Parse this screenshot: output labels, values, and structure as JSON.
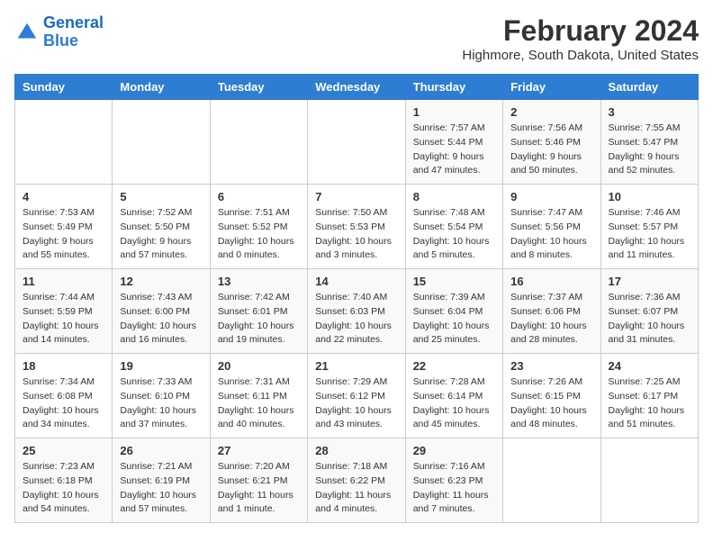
{
  "header": {
    "logo_line1": "General",
    "logo_line2": "Blue",
    "main_title": "February 2024",
    "subtitle": "Highmore, South Dakota, United States"
  },
  "columns": [
    "Sunday",
    "Monday",
    "Tuesday",
    "Wednesday",
    "Thursday",
    "Friday",
    "Saturday"
  ],
  "rows": [
    [
      {
        "day": "",
        "info": ""
      },
      {
        "day": "",
        "info": ""
      },
      {
        "day": "",
        "info": ""
      },
      {
        "day": "",
        "info": ""
      },
      {
        "day": "1",
        "info": "Sunrise: 7:57 AM\nSunset: 5:44 PM\nDaylight: 9 hours and 47 minutes."
      },
      {
        "day": "2",
        "info": "Sunrise: 7:56 AM\nSunset: 5:46 PM\nDaylight: 9 hours and 50 minutes."
      },
      {
        "day": "3",
        "info": "Sunrise: 7:55 AM\nSunset: 5:47 PM\nDaylight: 9 hours and 52 minutes."
      }
    ],
    [
      {
        "day": "4",
        "info": "Sunrise: 7:53 AM\nSunset: 5:49 PM\nDaylight: 9 hours and 55 minutes."
      },
      {
        "day": "5",
        "info": "Sunrise: 7:52 AM\nSunset: 5:50 PM\nDaylight: 9 hours and 57 minutes."
      },
      {
        "day": "6",
        "info": "Sunrise: 7:51 AM\nSunset: 5:52 PM\nDaylight: 10 hours and 0 minutes."
      },
      {
        "day": "7",
        "info": "Sunrise: 7:50 AM\nSunset: 5:53 PM\nDaylight: 10 hours and 3 minutes."
      },
      {
        "day": "8",
        "info": "Sunrise: 7:48 AM\nSunset: 5:54 PM\nDaylight: 10 hours and 5 minutes."
      },
      {
        "day": "9",
        "info": "Sunrise: 7:47 AM\nSunset: 5:56 PM\nDaylight: 10 hours and 8 minutes."
      },
      {
        "day": "10",
        "info": "Sunrise: 7:46 AM\nSunset: 5:57 PM\nDaylight: 10 hours and 11 minutes."
      }
    ],
    [
      {
        "day": "11",
        "info": "Sunrise: 7:44 AM\nSunset: 5:59 PM\nDaylight: 10 hours and 14 minutes."
      },
      {
        "day": "12",
        "info": "Sunrise: 7:43 AM\nSunset: 6:00 PM\nDaylight: 10 hours and 16 minutes."
      },
      {
        "day": "13",
        "info": "Sunrise: 7:42 AM\nSunset: 6:01 PM\nDaylight: 10 hours and 19 minutes."
      },
      {
        "day": "14",
        "info": "Sunrise: 7:40 AM\nSunset: 6:03 PM\nDaylight: 10 hours and 22 minutes."
      },
      {
        "day": "15",
        "info": "Sunrise: 7:39 AM\nSunset: 6:04 PM\nDaylight: 10 hours and 25 minutes."
      },
      {
        "day": "16",
        "info": "Sunrise: 7:37 AM\nSunset: 6:06 PM\nDaylight: 10 hours and 28 minutes."
      },
      {
        "day": "17",
        "info": "Sunrise: 7:36 AM\nSunset: 6:07 PM\nDaylight: 10 hours and 31 minutes."
      }
    ],
    [
      {
        "day": "18",
        "info": "Sunrise: 7:34 AM\nSunset: 6:08 PM\nDaylight: 10 hours and 34 minutes."
      },
      {
        "day": "19",
        "info": "Sunrise: 7:33 AM\nSunset: 6:10 PM\nDaylight: 10 hours and 37 minutes."
      },
      {
        "day": "20",
        "info": "Sunrise: 7:31 AM\nSunset: 6:11 PM\nDaylight: 10 hours and 40 minutes."
      },
      {
        "day": "21",
        "info": "Sunrise: 7:29 AM\nSunset: 6:12 PM\nDaylight: 10 hours and 43 minutes."
      },
      {
        "day": "22",
        "info": "Sunrise: 7:28 AM\nSunset: 6:14 PM\nDaylight: 10 hours and 45 minutes."
      },
      {
        "day": "23",
        "info": "Sunrise: 7:26 AM\nSunset: 6:15 PM\nDaylight: 10 hours and 48 minutes."
      },
      {
        "day": "24",
        "info": "Sunrise: 7:25 AM\nSunset: 6:17 PM\nDaylight: 10 hours and 51 minutes."
      }
    ],
    [
      {
        "day": "25",
        "info": "Sunrise: 7:23 AM\nSunset: 6:18 PM\nDaylight: 10 hours and 54 minutes."
      },
      {
        "day": "26",
        "info": "Sunrise: 7:21 AM\nSunset: 6:19 PM\nDaylight: 10 hours and 57 minutes."
      },
      {
        "day": "27",
        "info": "Sunrise: 7:20 AM\nSunset: 6:21 PM\nDaylight: 11 hours and 1 minute."
      },
      {
        "day": "28",
        "info": "Sunrise: 7:18 AM\nSunset: 6:22 PM\nDaylight: 11 hours and 4 minutes."
      },
      {
        "day": "29",
        "info": "Sunrise: 7:16 AM\nSunset: 6:23 PM\nDaylight: 11 hours and 7 minutes."
      },
      {
        "day": "",
        "info": ""
      },
      {
        "day": "",
        "info": ""
      }
    ]
  ]
}
